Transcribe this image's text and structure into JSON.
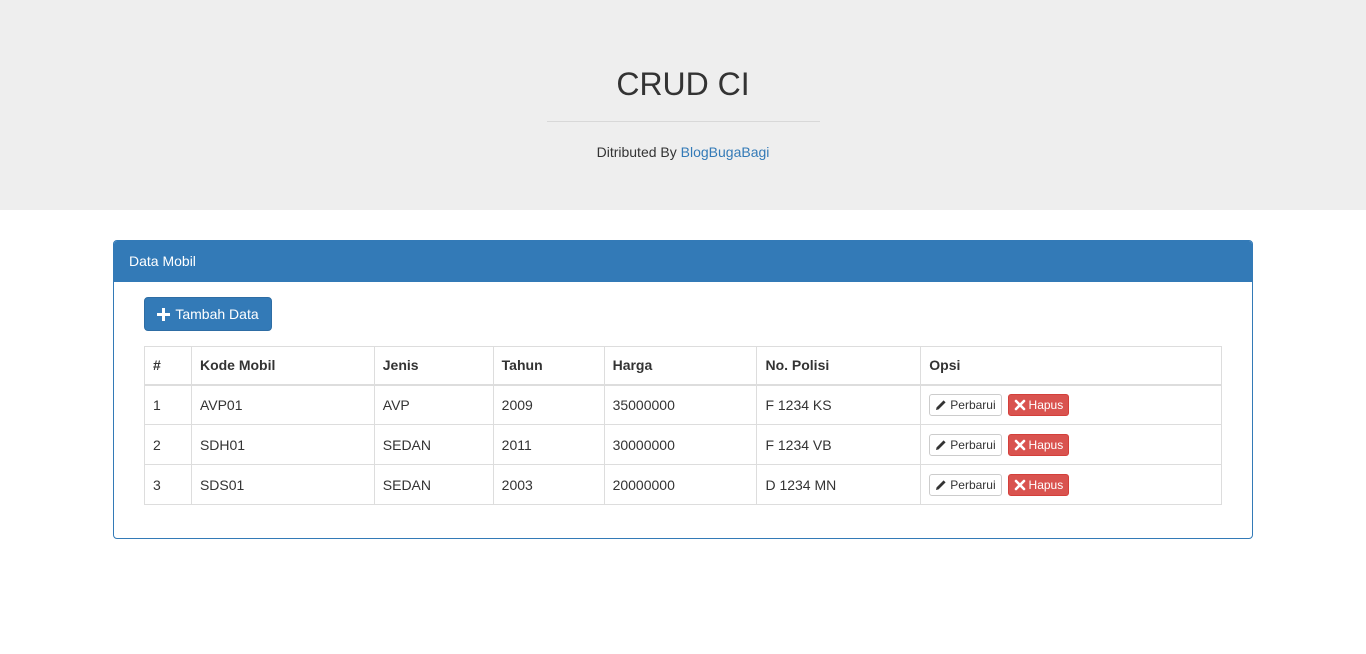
{
  "header": {
    "title": "CRUD CI",
    "subtitle_prefix": "Ditributed By",
    "subtitle_link": "BlogBugaBagi"
  },
  "panel": {
    "title": "Data Mobil",
    "add_button_label": "Tambah Data"
  },
  "table": {
    "columns": [
      "#",
      "Kode Mobil",
      "Jenis",
      "Tahun",
      "Harga",
      "No. Polisi",
      "Opsi"
    ],
    "rows": [
      {
        "no": "1",
        "kode": "AVP01",
        "jenis": "AVP",
        "tahun": "2009",
        "harga": "35000000",
        "polisi": "F 1234 KS"
      },
      {
        "no": "2",
        "kode": "SDH01",
        "jenis": "SEDAN",
        "tahun": "2011",
        "harga": "30000000",
        "polisi": "F 1234 VB"
      },
      {
        "no": "3",
        "kode": "SDS01",
        "jenis": "SEDAN",
        "tahun": "2003",
        "harga": "20000000",
        "polisi": "D 1234 MN"
      }
    ],
    "edit_label": "Perbarui",
    "delete_label": "Hapus"
  },
  "colors": {
    "primary": "#337ab7",
    "danger": "#d9534f",
    "jumbotron_bg": "#eeeeee"
  }
}
